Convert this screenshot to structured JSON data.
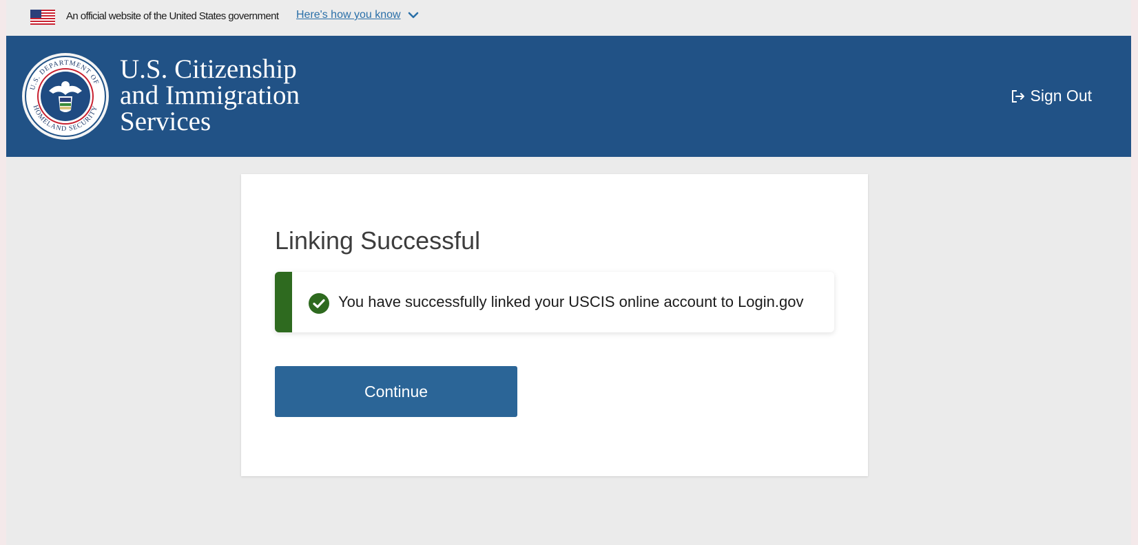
{
  "gov_banner": {
    "official_text": "An official website of the United States government",
    "how_you_know": "Here's how you know"
  },
  "header": {
    "agency_lines": [
      "U.S. Citizenship",
      "and Immigration",
      "Services"
    ],
    "sign_out": "Sign Out",
    "seal_text": "U.S. DEPARTMENT OF HOMELAND SECURITY"
  },
  "main": {
    "title": "Linking Successful",
    "alert_message": "You have successfully linked your USCIS online account to Login.gov",
    "continue_label": "Continue"
  },
  "colors": {
    "header_bg": "#215286",
    "button_bg": "#2b6597",
    "success": "#2e6a1f",
    "link": "#2a6fa8"
  }
}
